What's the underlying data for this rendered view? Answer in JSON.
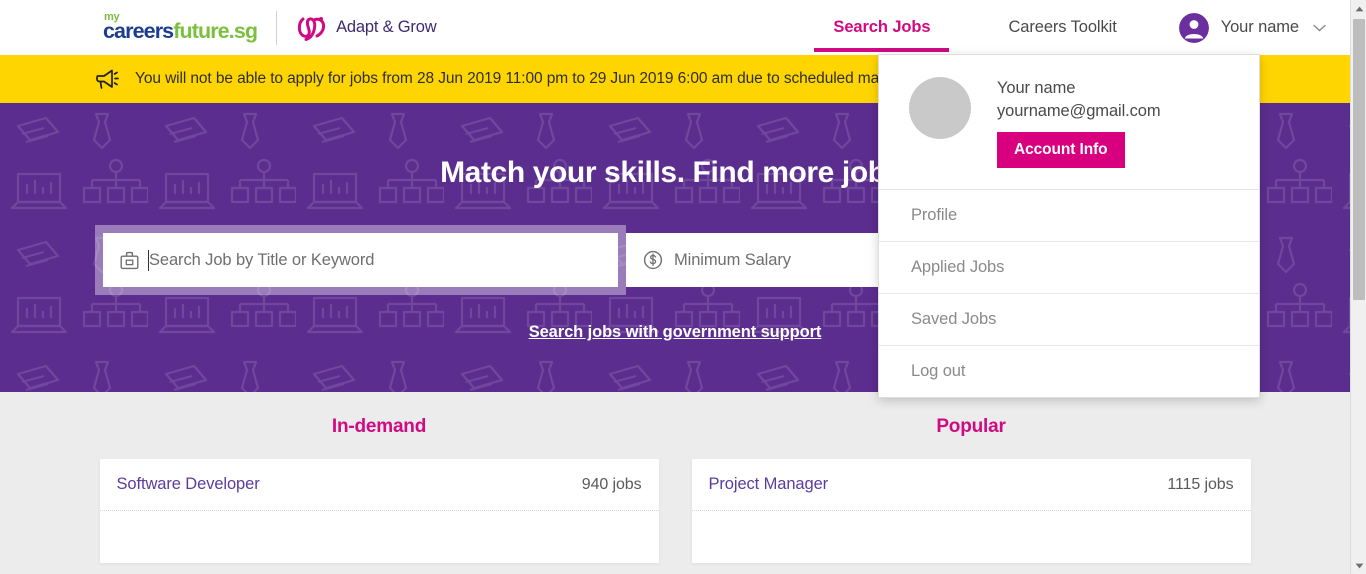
{
  "brand": {
    "mcf_my": "my",
    "mcf_careers": "careers",
    "mcf_future": "future.sg",
    "adapt_grow": "Adapt & Grow"
  },
  "nav": {
    "search_jobs": "Search Jobs",
    "careers_toolkit": "Careers Toolkit",
    "user_name": "Your name"
  },
  "banner": {
    "text": "You will not be able to apply for jobs from 28 Jun 2019 11:00 pm to 29 Jun 2019 6:00 am due to scheduled maintenance."
  },
  "hero": {
    "title": "Match your skills. Find more jobs.",
    "search_placeholder": "Search Job by Title or Keyword",
    "salary_placeholder": "Minimum Salary",
    "gov_link": "Search jobs with government support"
  },
  "dropdown": {
    "name": "Your name",
    "email": "yourname@gmail.com",
    "account_info": "Account Info",
    "items": [
      {
        "label": "Profile"
      },
      {
        "label": "Applied Jobs"
      },
      {
        "label": "Saved Jobs"
      },
      {
        "label": "Log out"
      }
    ]
  },
  "sections": [
    {
      "heading": "In-demand",
      "rows": [
        {
          "title": "Software Developer",
          "count": "940 jobs"
        },
        {
          "title": "",
          "count": ""
        }
      ]
    },
    {
      "heading": "Popular",
      "rows": [
        {
          "title": "Project Manager",
          "count": "1115 jobs"
        },
        {
          "title": "",
          "count": ""
        }
      ]
    }
  ],
  "colors": {
    "brand_pink": "#cf0a83",
    "brand_purple": "#5b2d8e",
    "banner_yellow": "#ffd500",
    "logo_green": "#7bbf3f",
    "logo_blue": "#1b3d8f",
    "account_btn": "#d9007f"
  }
}
